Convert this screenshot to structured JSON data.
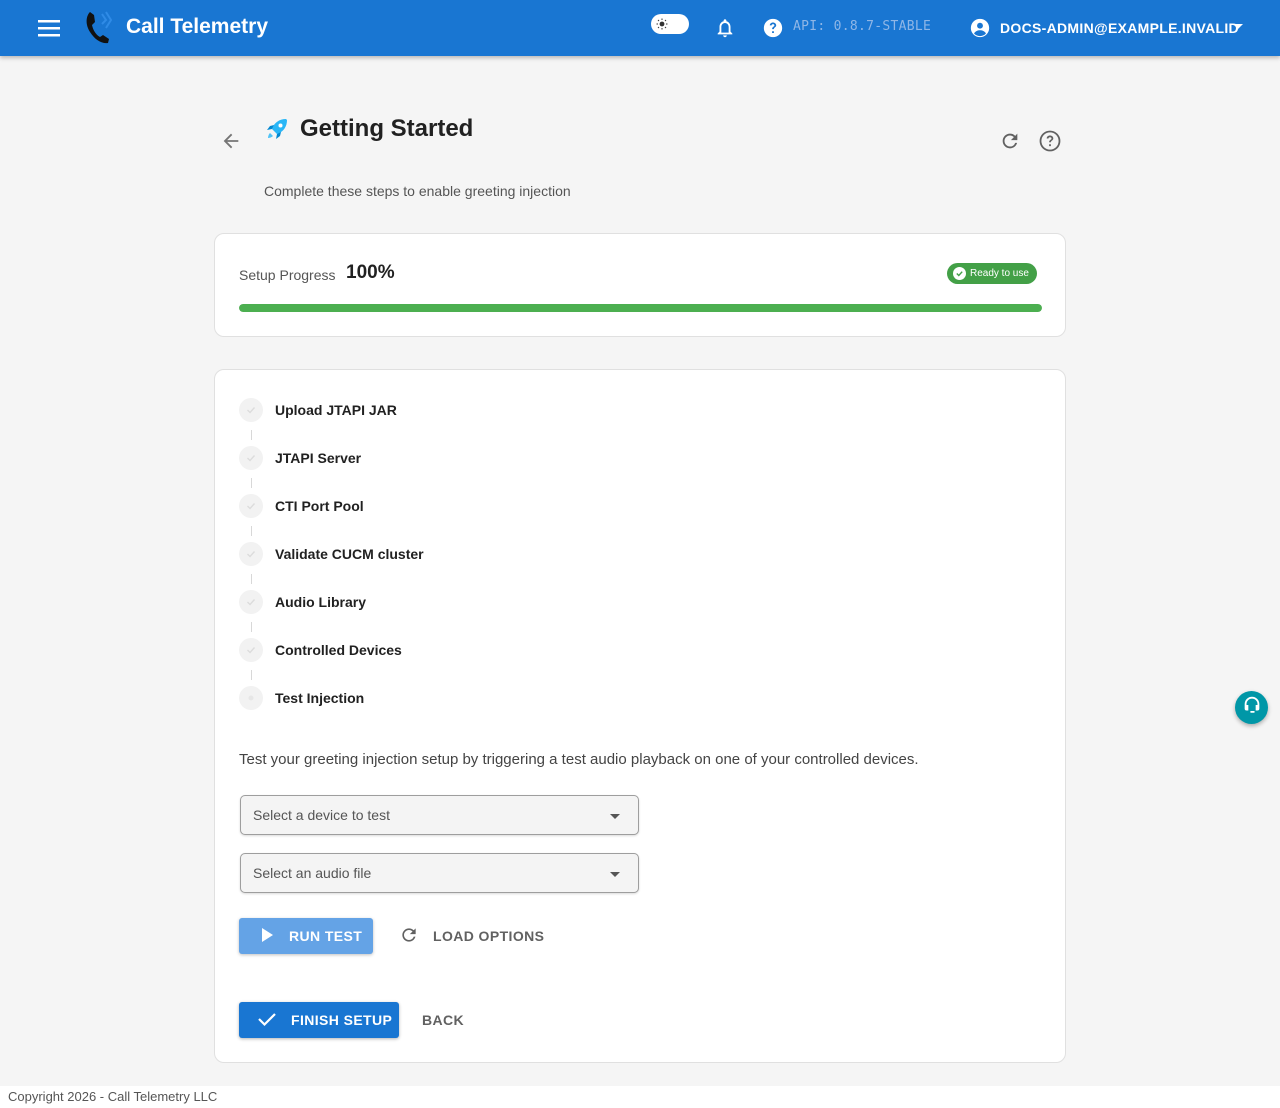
{
  "appbar": {
    "title": "Call Telemetry",
    "api_version": "API: 0.8.7-STABLE",
    "account": "DOCS-ADMIN@EXAMPLE.INVALID",
    "icons": [
      "menu-icon",
      "phone-logo-icon",
      "theme-toggle",
      "bell-icon",
      "help-icon",
      "account-icon",
      "caret-down-icon"
    ]
  },
  "header": {
    "title": "Getting Started",
    "subtitle": "Complete these steps to enable greeting injection"
  },
  "progress": {
    "label": "Setup Progress",
    "value": "100%",
    "fraction": 1.0,
    "badge": "Ready to use"
  },
  "steps": [
    {
      "label": "Upload JTAPI JAR",
      "state": "complete"
    },
    {
      "label": "JTAPI Server",
      "state": "complete"
    },
    {
      "label": "CTI Port Pool",
      "state": "complete"
    },
    {
      "label": "Validate CUCM cluster",
      "state": "complete"
    },
    {
      "label": "Audio Library",
      "state": "complete"
    },
    {
      "label": "Controlled Devices",
      "state": "complete"
    },
    {
      "label": "Test Injection",
      "state": "current"
    }
  ],
  "test": {
    "description": "Test your greeting injection setup by triggering a test audio playback on one of your controlled devices.",
    "device_placeholder": "Select a device to test",
    "audio_placeholder": "Select an audio file",
    "run_label": "RUN TEST",
    "load_label": "LOAD OPTIONS"
  },
  "actions": {
    "finish_label": "FINISH SETUP",
    "back_label": "BACK"
  },
  "footer": {
    "copyright": "Copyright 2026 - Call Telemetry LLC"
  },
  "colors": {
    "primary": "#1976d2",
    "success": "#4caf50",
    "fab": "#0097a7"
  }
}
